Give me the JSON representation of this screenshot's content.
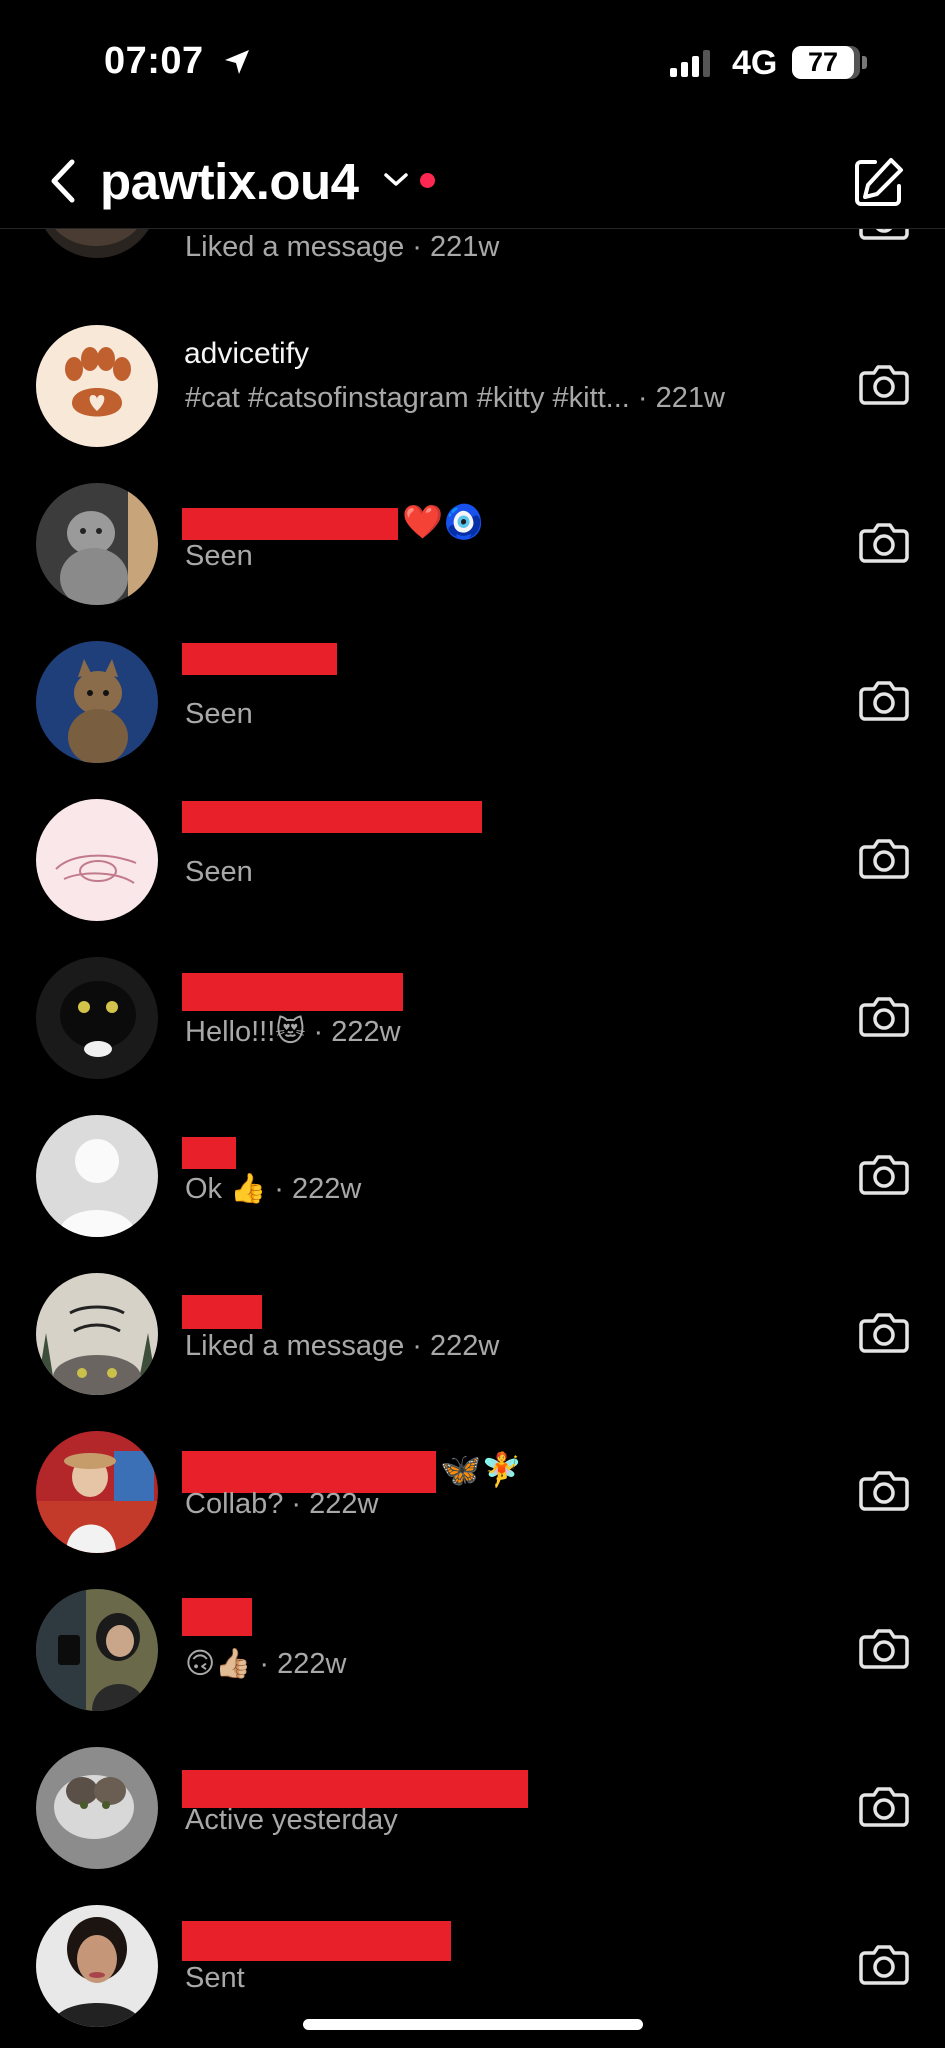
{
  "status_bar": {
    "time": "07:07",
    "network": "4G",
    "battery": "77"
  },
  "header": {
    "account_name": "pawtix.ou4"
  },
  "threads": [
    {
      "name": "",
      "preview": "Liked a message · 221w",
      "emoji": ""
    },
    {
      "name": "advicetify",
      "preview": "#cat #catsofinstagram #kitty #kitt...  · 221w",
      "emoji": ""
    },
    {
      "name": "",
      "preview": "Seen",
      "emoji": "❤️🧿"
    },
    {
      "name": "",
      "preview": "Seen",
      "emoji": ""
    },
    {
      "name": "",
      "preview": "Seen",
      "emoji": ""
    },
    {
      "name": "",
      "preview": "Hello!!!😻 · 222w",
      "emoji": ""
    },
    {
      "name": "",
      "preview": "Ok 👍 · 222w",
      "emoji": ""
    },
    {
      "name": "",
      "preview": "Liked a message · 222w",
      "emoji": ""
    },
    {
      "name": "",
      "preview": "Collab? · 222w",
      "emoji": "🦋🧚"
    },
    {
      "name": "",
      "preview": "🙃👍🏼 · 222w",
      "emoji": ""
    },
    {
      "name": "",
      "preview": "Active yesterday",
      "emoji": ""
    },
    {
      "name": "",
      "preview": "Sent",
      "emoji": ""
    }
  ],
  "icons": {
    "back": "chevron-left-icon",
    "dropdown": "chevron-down-icon",
    "compose": "compose-icon",
    "camera": "camera-icon",
    "location": "location-arrow-icon",
    "signal": "signal-icon"
  },
  "colors": {
    "background": "#000000",
    "secondary_text": "#a8a8a8",
    "redaction": "#e8202a",
    "notification_dot": "#ff2851"
  }
}
